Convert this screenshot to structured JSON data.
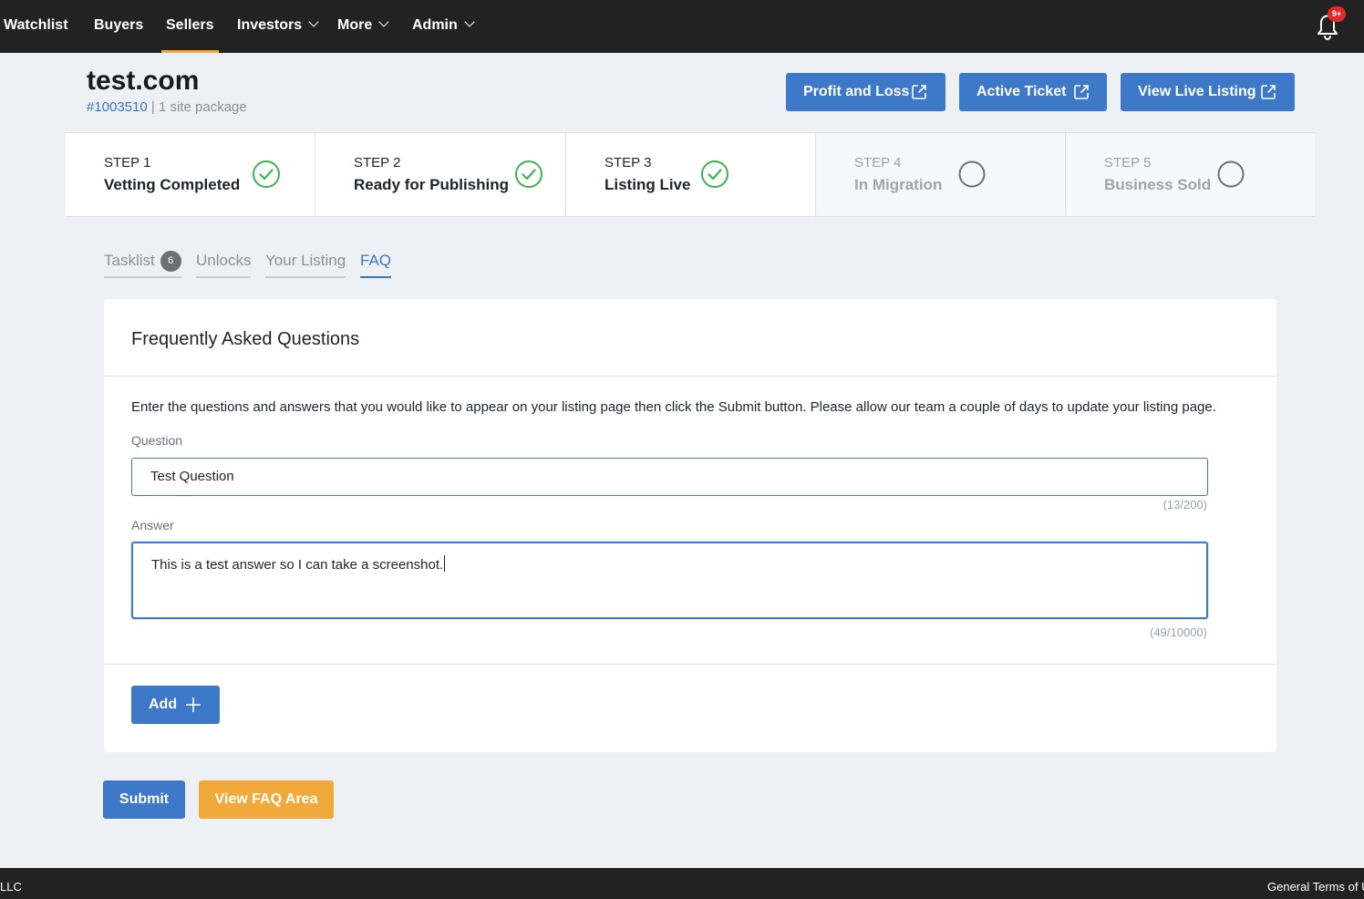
{
  "nav": {
    "items": [
      {
        "label": "Watchlist"
      },
      {
        "label": "Buyers"
      },
      {
        "label": "Sellers"
      },
      {
        "label": "Investors"
      },
      {
        "label": "More"
      },
      {
        "label": "Admin"
      }
    ],
    "active": "Sellers",
    "notification_badge": "9+"
  },
  "header": {
    "title": "test.com",
    "listing_id": "#1003510",
    "separator": "|",
    "package": "1 site package",
    "buttons": [
      {
        "label": "Profit and Loss",
        "icon": "external-link-icon"
      },
      {
        "label": "Active Ticket",
        "icon": "external-link-icon"
      },
      {
        "label": "View Live Listing",
        "icon": "external-link-icon"
      }
    ]
  },
  "steps": [
    {
      "number": "STEP 1",
      "name": "Vetting Completed",
      "status": "complete"
    },
    {
      "number": "STEP 2",
      "name": "Ready for Publishing",
      "status": "complete"
    },
    {
      "number": "STEP 3",
      "name": "Listing Live",
      "status": "complete"
    },
    {
      "number": "STEP 4",
      "name": "In Migration",
      "status": "pending"
    },
    {
      "number": "STEP 5",
      "name": "Business Sold",
      "status": "pending"
    }
  ],
  "tabs": [
    {
      "label": "Tasklist",
      "count": "6"
    },
    {
      "label": "Unlocks"
    },
    {
      "label": "Your Listing"
    },
    {
      "label": "FAQ"
    }
  ],
  "active_tab": "FAQ",
  "faq": {
    "title": "Frequently Asked Questions",
    "intro": "Enter the questions and answers that you would like to appear on your listing page then click the Submit button. Please allow our team a couple of days to update your listing page.",
    "question_label": "Question",
    "question_value": "Test Question",
    "question_counter": "(13/200)",
    "answer_label": "Answer",
    "answer_value": "This is a test answer so I can take a screenshot.",
    "answer_counter": "(49/10000)",
    "add_label": "Add"
  },
  "actions": {
    "submit_label": "Submit",
    "view_faq_label": "View FAQ Area"
  },
  "footer": {
    "left": "LLC",
    "right": "General Terms of Use"
  },
  "colors": {
    "primary": "#3e78c9",
    "accent": "#f0a93b",
    "success": "#3fb34f",
    "nav_bg": "#222222"
  }
}
